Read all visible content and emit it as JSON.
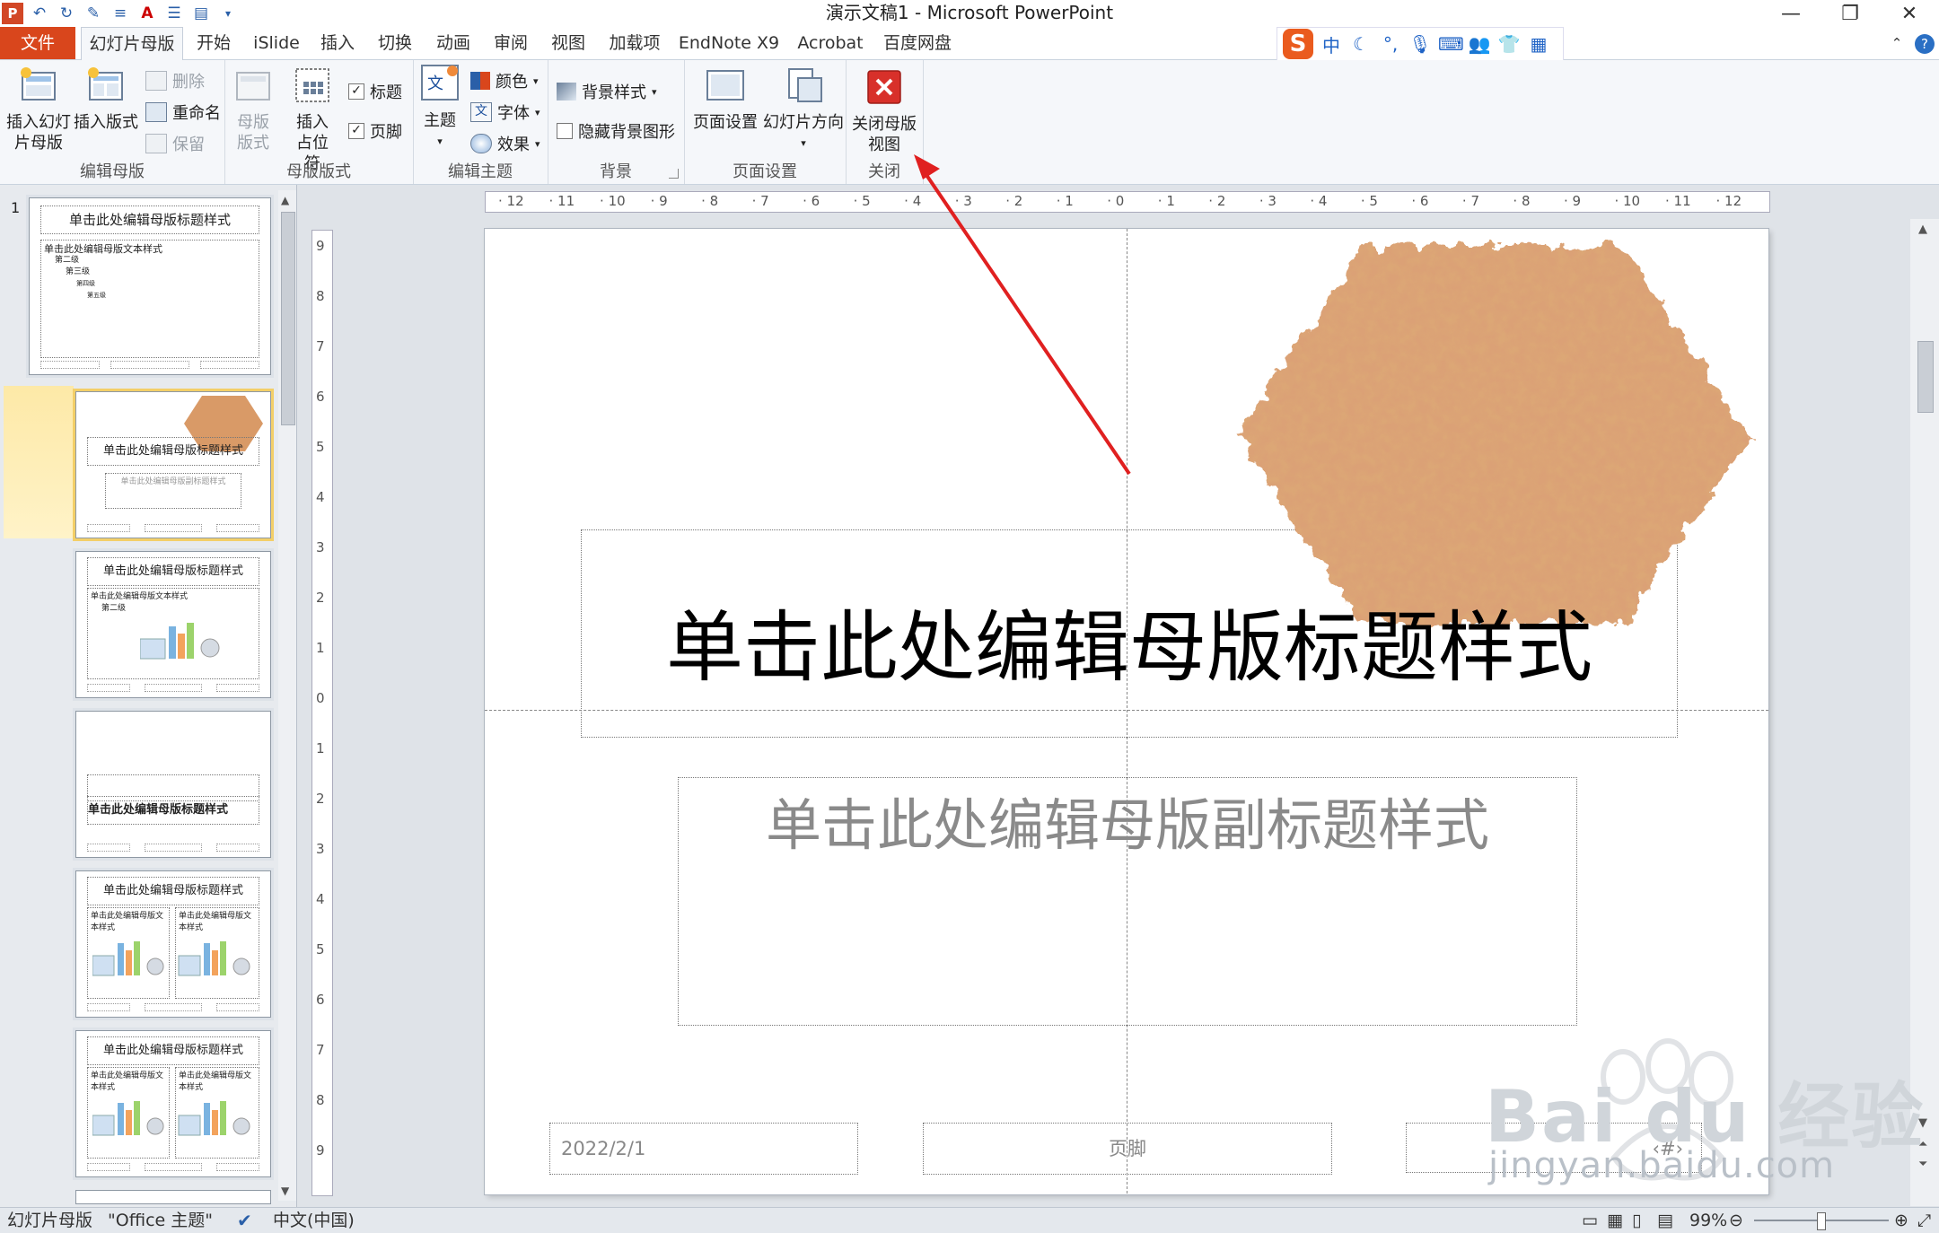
{
  "window": {
    "title": "演示文稿1 - Microsoft PowerPoint"
  },
  "tabs": [
    {
      "label": "文件",
      "state": "file"
    },
    {
      "label": "幻灯片母版",
      "state": "active"
    },
    {
      "label": "开始"
    },
    {
      "label": "iSlide"
    },
    {
      "label": "插入"
    },
    {
      "label": "切换"
    },
    {
      "label": "动画"
    },
    {
      "label": "审阅"
    },
    {
      "label": "视图"
    },
    {
      "label": "加载项"
    },
    {
      "label": "EndNote X9"
    },
    {
      "label": "Acrobat"
    },
    {
      "label": "百度网盘"
    }
  ],
  "ime": {
    "lang": "中",
    "logo": "S"
  },
  "ribbon": {
    "edit_master": {
      "label": "编辑母版",
      "insert_slide_master": "插入幻灯片母版",
      "insert_layout": "插入版式",
      "delete": "删除",
      "rename": "重命名",
      "preserve": "保留"
    },
    "master_layout": {
      "label": "母版版式",
      "master_layout_btn": "母版版式",
      "insert_placeholder": "插入占位符",
      "title_check": "标题",
      "footer_check": "页脚"
    },
    "edit_theme": {
      "label": "编辑主题",
      "theme": "主题",
      "colors": "颜色",
      "fonts": "字体",
      "effects": "效果"
    },
    "background": {
      "label": "背景",
      "bg_styles": "背景样式",
      "hide_bg": "隐藏背景图形"
    },
    "page_setup": {
      "label": "页面设置",
      "page_setup_btn": "页面设置",
      "orientation": "幻灯片方向"
    },
    "close": {
      "label": "关闭",
      "close_master": "关闭母版视图"
    }
  },
  "thumbnails": {
    "number": "1",
    "master_title": "单击此处编辑母版标题样式",
    "master_body": [
      "单击此处编辑母版文本样式",
      "第二级",
      "第三级",
      "第四级",
      "第五级"
    ],
    "layout_title": "单击此处编辑母版标题样式",
    "layout_sub": "单击此处编辑母版副标题样式",
    "content_body": [
      "单击此处编辑母版文本样式",
      "第二级"
    ]
  },
  "slide": {
    "title": "单击此处编辑母版标题样式",
    "subtitle": "单击此处编辑母版副标题样式",
    "date": "2022/2/1",
    "footer": "页脚",
    "number": "‹#›"
  },
  "rulers": {
    "h_ticks": [
      "12",
      "11",
      "10",
      "9",
      "8",
      "7",
      "6",
      "5",
      "4",
      "3",
      "2",
      "1",
      "0",
      "1",
      "2",
      "3",
      "4",
      "5",
      "6",
      "7",
      "8",
      "9",
      "10",
      "11",
      "12"
    ],
    "v_ticks": [
      "9",
      "8",
      "7",
      "6",
      "5",
      "4",
      "3",
      "2",
      "1",
      "0",
      "1",
      "2",
      "3",
      "4",
      "5",
      "6",
      "7",
      "8",
      "9"
    ]
  },
  "status": {
    "view": "幻灯片母版",
    "theme": "\"Office 主题\"",
    "language": "中文(中国)",
    "zoom": "99%"
  },
  "watermark": {
    "brand": "Bai du 经验",
    "url": "jingyan.baidu.com"
  },
  "colors": {
    "file_tab": "#d9461c",
    "accent": "#2a5fa8",
    "texture": "#d99a67",
    "arrow": "#e02020"
  }
}
